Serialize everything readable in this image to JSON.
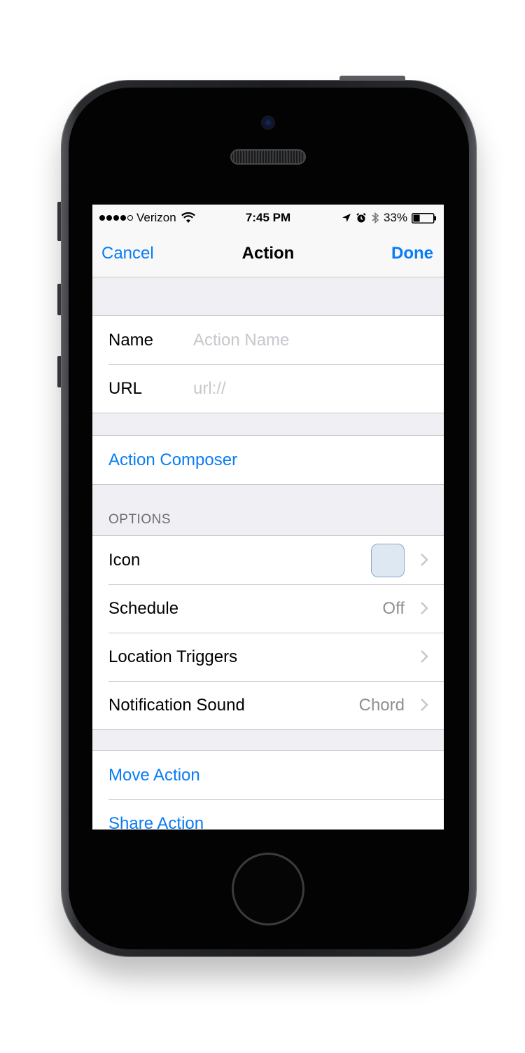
{
  "status_bar": {
    "carrier": "Verizon",
    "time": "7:45 PM",
    "battery": "33%",
    "signal_bars_filled": 4,
    "battery_level": 0.33
  },
  "nav": {
    "cancel": "Cancel",
    "title": "Action",
    "done": "Done"
  },
  "form": {
    "name_label": "Name",
    "name_placeholder": "Action Name",
    "url_label": "URL",
    "url_placeholder": "url://"
  },
  "composer": {
    "label": "Action Composer"
  },
  "options": {
    "header": "OPTIONS",
    "icon_label": "Icon",
    "schedule_label": "Schedule",
    "schedule_value": "Off",
    "location_label": "Location Triggers",
    "sound_label": "Notification Sound",
    "sound_value": "Chord"
  },
  "actions": {
    "move": "Move Action",
    "share": "Share Action"
  },
  "colors": {
    "accent": "#0a7cf5",
    "placeholder": "#c7c7cd",
    "secondary_text": "#8e8e93",
    "grouped_background": "#efeff4",
    "icon_swatch": "#dde8f3"
  }
}
